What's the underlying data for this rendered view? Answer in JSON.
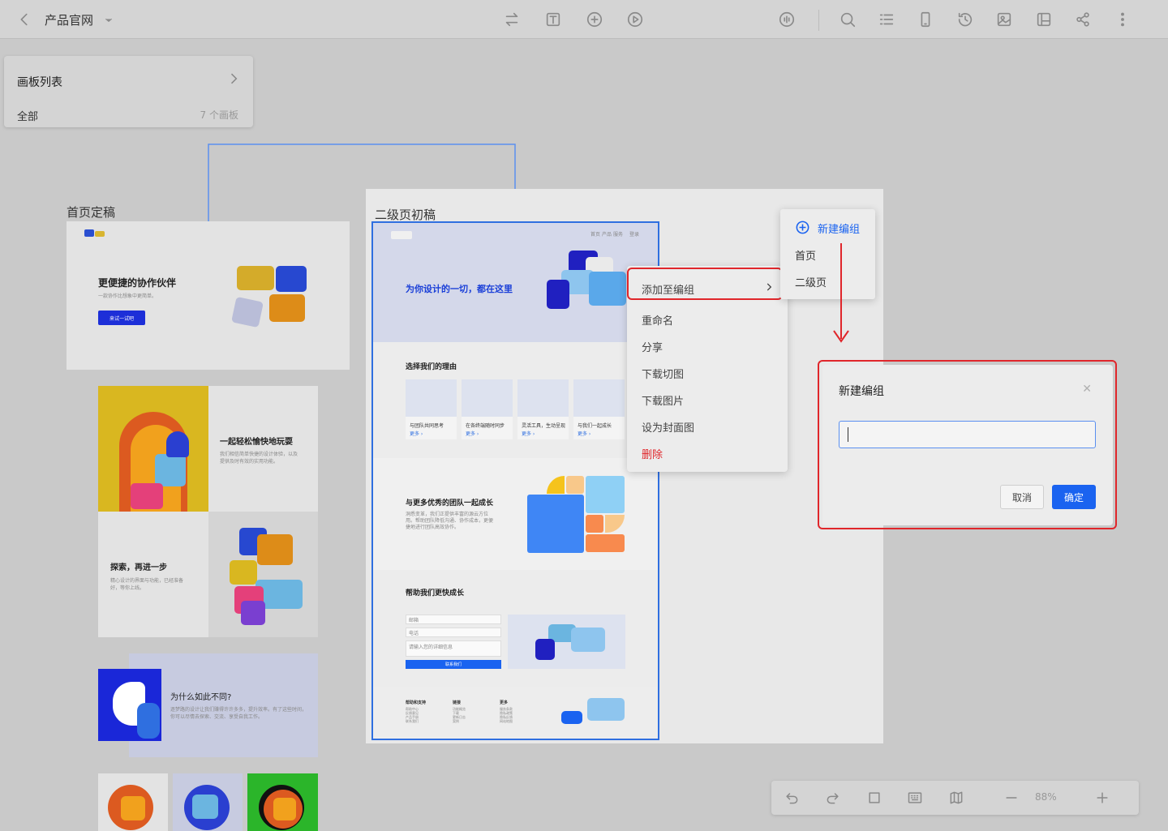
{
  "toolbar": {
    "project_title": "产品官网"
  },
  "board_list": {
    "title": "画板列表",
    "filter": "全部",
    "count": "7 个画板"
  },
  "boards": {
    "home_label": "首页定稿",
    "secondary_label": "二级页初稿"
  },
  "home_board": {
    "hero_title": "更便捷的协作伙伴",
    "hero_sub": "一款协作比想象中更简单。",
    "hero_button": "来试一试吧",
    "section2_title": "一起轻松愉快地玩耍",
    "section2_text": "我们相信简单快捷的设计体验，以及提供及时有效的实用功能。",
    "section3_title": "探索，再进一步",
    "section3_text": "精心设计的界面与功能，已经准备好，等你上线。",
    "section4_title": "为什么如此不同?",
    "section4_text": "逐梦路的设计让我们赚得许许多多，提升效率。有了这些时间，你可以尽情去探索、交流、享受自我工作。"
  },
  "secondary_board": {
    "hero_title": "为你设计的一切，都在这里",
    "nav": [
      "首页",
      "产品",
      "服务",
      "登录"
    ],
    "reasons_title": "选择我们的理由",
    "reasons": [
      {
        "label": "与团队共同思考",
        "link": "更多 ›"
      },
      {
        "label": "在各终端随时同步",
        "link": "更多 ›"
      },
      {
        "label": "灵活工具，生动呈现",
        "link": "更多 ›"
      },
      {
        "label": "与我们一起成长",
        "link": "更多 ›"
      }
    ],
    "grow_title": "与更多优秀的团队一起成长",
    "grow_text": "洞悉变革，我们正提供丰富的源云方位用。帮助团队降低沟通、协作成本，更便捷地进行团队高效协作。",
    "help_title": "帮助我们更快成长",
    "form": {
      "email": "邮箱",
      "phone": "电话",
      "message": "请输入您的详细信息",
      "submit": "联系我们"
    },
    "footer": {
      "col1_title": "帮助和支持",
      "col1": [
        "帮助中心",
        "反馈意见",
        "产品手册",
        "联系我们"
      ],
      "col2_title": "链接",
      "col2": [
        "功能概览",
        "下载",
        "更新日志",
        "案例"
      ],
      "col3_title": "更多",
      "col3": [
        "服务条款",
        "隐私政策",
        "隐私反馈",
        "网站地图"
      ]
    }
  },
  "context_menu": {
    "items": [
      "添加至编组",
      "重命名",
      "分享",
      "下载切图",
      "下载图片",
      "设为封面图",
      "删除"
    ]
  },
  "submenu": {
    "new_group": "新建编组",
    "groups": [
      "首页",
      "二级页"
    ]
  },
  "dialog": {
    "title": "新建编组",
    "input_value": "",
    "cancel": "取消",
    "confirm": "确定"
  },
  "bottom_toolbar": {
    "zoom": "88%"
  },
  "colors": {
    "accent": "#1a63f0",
    "danger": "#e0262b",
    "selection": "#2f6fe0"
  }
}
